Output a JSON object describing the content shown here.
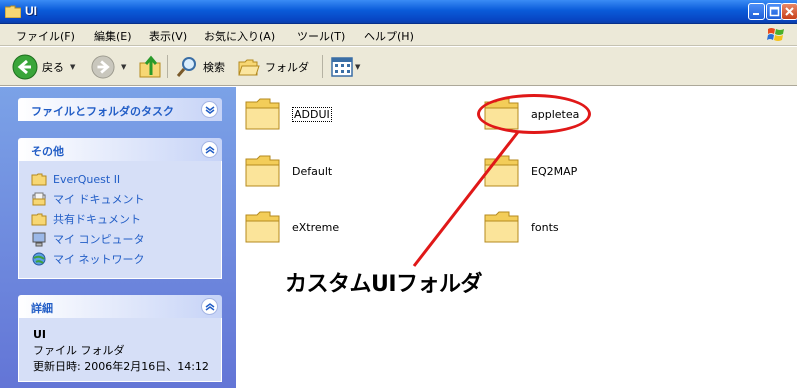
{
  "window": {
    "title": "UI"
  },
  "menu": {
    "items": [
      "ファイル(F)",
      "編集(E)",
      "表示(V)",
      "お気に入り(A)",
      "ツール(T)",
      "ヘルプ(H)"
    ]
  },
  "toolbar": {
    "back_label": "戻る",
    "search_label": "検索",
    "folders_label": "フォルダ"
  },
  "taskpane": {
    "file_tasks": {
      "title": "ファイルとフォルダのタスク"
    },
    "other_places": {
      "title": "その他",
      "items": [
        "EverQuest II",
        "マイ ドキュメント",
        "共有ドキュメント",
        "マイ コンピュータ",
        "マイ ネットワーク"
      ]
    },
    "details": {
      "title": "詳細",
      "name": "UI",
      "type": "ファイル フォルダ",
      "modified": "更新日時: 2006年2月16日、14:12"
    }
  },
  "folders": [
    {
      "name": "ADDUI",
      "selected": true
    },
    {
      "name": "appletea",
      "selected": false
    },
    {
      "name": "Default",
      "selected": false
    },
    {
      "name": "EQ2MAP",
      "selected": false
    },
    {
      "name": "eXtreme",
      "selected": false
    },
    {
      "name": "fonts",
      "selected": false
    }
  ],
  "annotation": {
    "text": "カスタムUIフォルダ",
    "color": "#e01818"
  },
  "colors": {
    "titlebar": "#0a5bd9",
    "taskpane": "#6375d6",
    "link": "#215dc6"
  }
}
